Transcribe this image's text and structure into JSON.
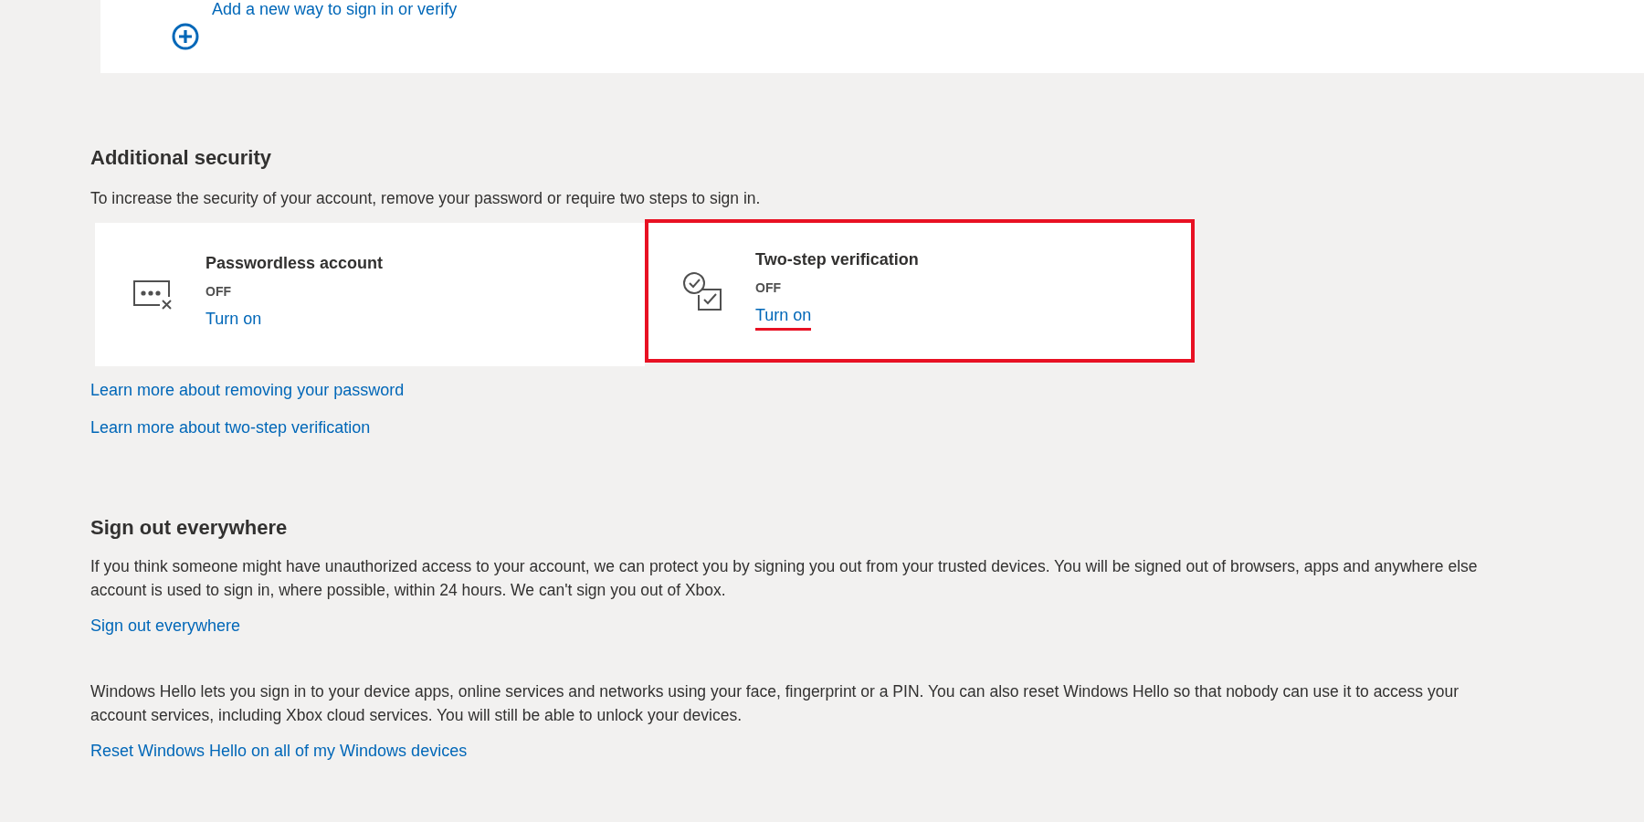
{
  "add_method": {
    "label": "Add a new way to sign in or verify"
  },
  "additional_security": {
    "heading": "Additional security",
    "description": "To increase the security of your account, remove your password or require two steps to sign in.",
    "cards": [
      {
        "kind": "passwordless",
        "title": "Passwordless account",
        "status": "OFF",
        "action": "Turn on",
        "highlighted": false
      },
      {
        "kind": "two_step",
        "title": "Two-step verification",
        "status": "OFF",
        "action": "Turn on",
        "highlighted": true
      }
    ],
    "links": [
      "Learn more about removing your password",
      "Learn more about two-step verification"
    ]
  },
  "sign_out": {
    "heading": "Sign out everywhere",
    "paragraph_lines": [
      "If you think someone might have unauthorized access to your account, we can protect you by signing you out from your trusted devices. You will be signed out of browsers, apps and anywhere else",
      "account is used to sign in, where possible, within 24 hours. We can't sign you out of Xbox."
    ],
    "link": "Sign out everywhere"
  },
  "windows_hello": {
    "paragraph_lines": [
      "Windows Hello lets you sign in to your device apps, online services and networks using your face, fingerprint or a PIN. You can also reset Windows Hello so that nobody can use it to access your",
      "account services, including Xbox cloud services. You will still be able to unlock your devices."
    ],
    "link": "Reset Windows Hello on all of my Windows devices"
  }
}
